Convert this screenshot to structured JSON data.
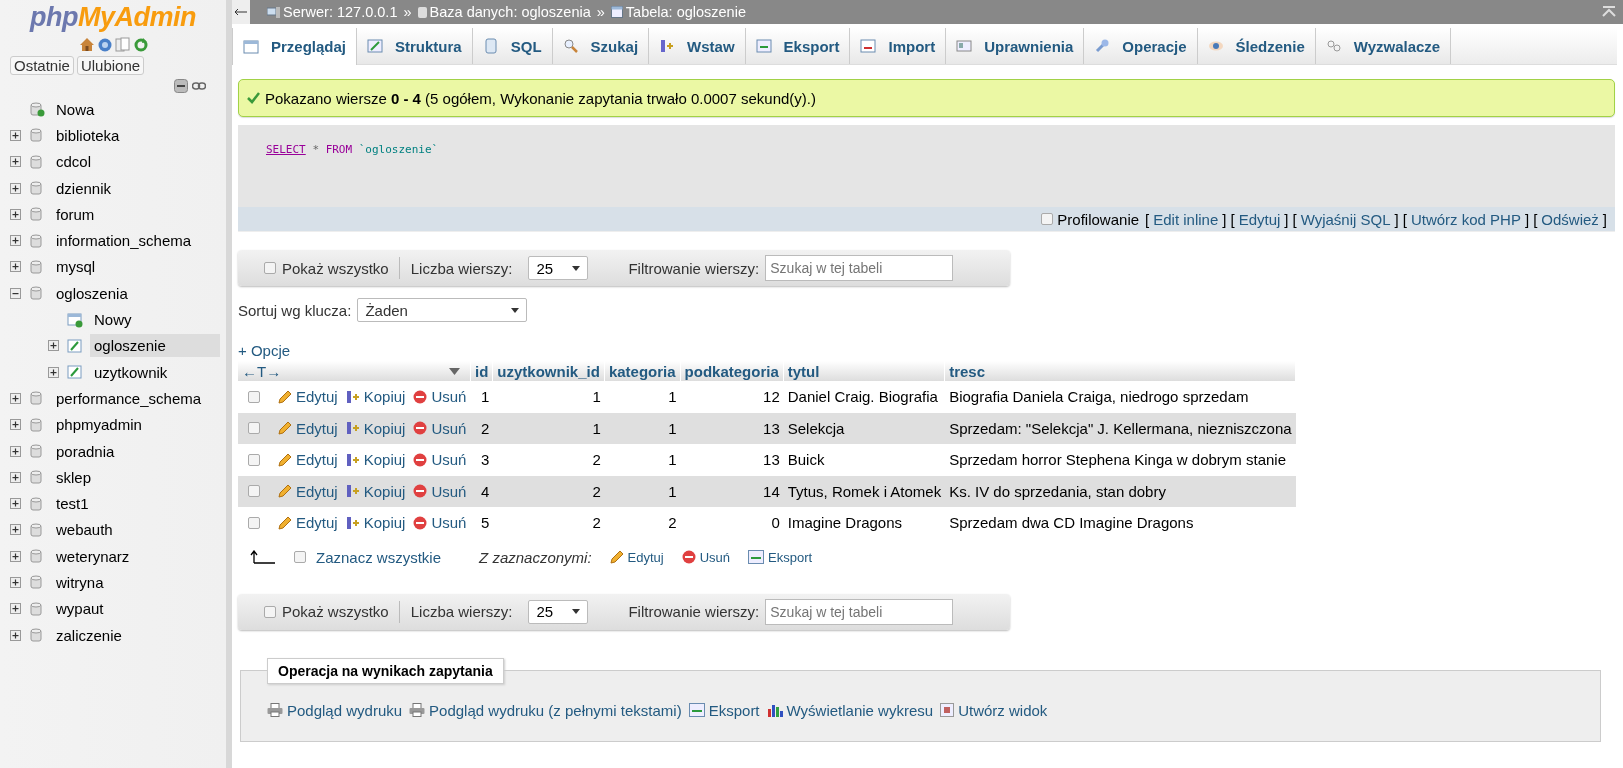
{
  "logo": [
    "php",
    "MyAdmin"
  ],
  "sidebar_tabs": [
    "Ostatnie",
    "Ulubione"
  ],
  "tree": [
    {
      "label": "Nowa",
      "kind": "new",
      "selected": false
    },
    {
      "label": "biblioteka",
      "kind": "db",
      "expanded": false,
      "selected": false
    },
    {
      "label": "cdcol",
      "kind": "db",
      "expanded": false,
      "selected": false
    },
    {
      "label": "dziennik",
      "kind": "db",
      "expanded": false,
      "selected": false
    },
    {
      "label": "forum",
      "kind": "db",
      "expanded": false,
      "selected": false
    },
    {
      "label": "information_schema",
      "kind": "db",
      "expanded": false,
      "selected": false
    },
    {
      "label": "mysql",
      "kind": "db",
      "expanded": false,
      "selected": false
    },
    {
      "label": "ogloszenia",
      "kind": "db",
      "expanded": true,
      "selected": false,
      "children": [
        {
          "label": "Nowy",
          "kind": "new",
          "selected": false
        },
        {
          "label": "ogloszenie",
          "kind": "table",
          "expanded": false,
          "selected": true
        },
        {
          "label": "uzytkownik",
          "kind": "table",
          "expanded": false,
          "selected": false
        }
      ]
    },
    {
      "label": "performance_schema",
      "kind": "db",
      "expanded": false,
      "selected": false
    },
    {
      "label": "phpmyadmin",
      "kind": "db",
      "expanded": false,
      "selected": false
    },
    {
      "label": "poradnia",
      "kind": "db",
      "expanded": false,
      "selected": false
    },
    {
      "label": "sklep",
      "kind": "db",
      "expanded": false,
      "selected": false
    },
    {
      "label": "test1",
      "kind": "db",
      "expanded": false,
      "selected": false
    },
    {
      "label": "webauth",
      "kind": "db",
      "expanded": false,
      "selected": false
    },
    {
      "label": "weterynarz",
      "kind": "db",
      "expanded": false,
      "selected": false
    },
    {
      "label": "witryna",
      "kind": "db",
      "expanded": false,
      "selected": false
    },
    {
      "label": "wypaut",
      "kind": "db",
      "expanded": false,
      "selected": false
    },
    {
      "label": "zaliczenie",
      "kind": "db",
      "expanded": false,
      "selected": false
    }
  ],
  "breadcrumb_separator": "»",
  "breadcrumb": [
    {
      "kind": "server",
      "label": "Serwer: 127.0.0.1"
    },
    {
      "kind": "db",
      "label": "Baza danych: ogloszenia"
    },
    {
      "kind": "table",
      "label": "Tabela: ogloszenie"
    }
  ],
  "tabs": [
    {
      "label": "Przeglądaj",
      "selected": true
    },
    {
      "label": "Struktura",
      "selected": false
    },
    {
      "label": "SQL",
      "selected": false
    },
    {
      "label": "Szukaj",
      "selected": false
    },
    {
      "label": "Wstaw",
      "selected": false
    },
    {
      "label": "Eksport",
      "selected": false
    },
    {
      "label": "Import",
      "selected": false
    },
    {
      "label": "Uprawnienia",
      "selected": false
    },
    {
      "label": "Operacje",
      "selected": false
    },
    {
      "label": "Śledzenie",
      "selected": false
    },
    {
      "label": "Wyzwalacze",
      "selected": false
    }
  ],
  "message": "Pokazano wiersze **0 - 4** (5 ogółem, Wykonanie zapytania trwało 0.0007 sekund(y).)",
  "sql": [
    {
      "kind": "keyword",
      "text": "SELECT"
    },
    {
      "kind": "operator",
      "text": "*"
    },
    {
      "kind": "keyword2",
      "text": "FROM"
    },
    {
      "kind": "identifier",
      "text": "`ogloszenie`"
    }
  ],
  "profiling": {
    "label": "Profilowanie",
    "checked": false,
    "bracket_open": "[",
    "bracket_close": "]",
    "links": [
      "Edit inline",
      "Edytuj",
      "Wyjaśnij SQL",
      "Utwórz kod PHP",
      "Odśwież"
    ]
  },
  "nav_bars": [
    {
      "show_all": {
        "label": "Pokaż wszystko",
        "checked": false
      },
      "rows_label": "Liczba wierszy:",
      "rows_value": "25",
      "filter_label": "Filtrowanie wierszy:",
      "filter_placeholder": "Szukaj w tej tabeli"
    },
    {
      "show_all": {
        "label": "Pokaż wszystko",
        "checked": false
      },
      "rows_label": "Liczba wierszy:",
      "rows_value": "25",
      "filter_label": "Filtrowanie wierszy:",
      "filter_placeholder": "Szukaj w tej tabeli"
    }
  ],
  "sort": {
    "label": "Sortuj wg klucza:",
    "value": "Żaden"
  },
  "options_link": "+ Opcje",
  "table": {
    "column_controls": "←T→",
    "columns": [
      "id",
      "uzytkownik_id",
      "kategoria",
      "podkategoria",
      "tytul",
      "tresc"
    ],
    "rows": [
      {
        "checked": false,
        "actions": [
          {
            "kind": "edit",
            "label": "Edytuj"
          },
          {
            "kind": "copy",
            "label": "Kopiuj"
          },
          {
            "kind": "delete",
            "label": "Usuń"
          }
        ],
        "cells": [
          "1",
          "1",
          "1",
          "12",
          "Daniel Craig. Biografia",
          "Biografia Daniela Craiga, niedrogo sprzedam"
        ]
      },
      {
        "checked": false,
        "actions": [
          {
            "kind": "edit",
            "label": "Edytuj"
          },
          {
            "kind": "copy",
            "label": "Kopiuj"
          },
          {
            "kind": "delete",
            "label": "Usuń"
          }
        ],
        "cells": [
          "2",
          "1",
          "1",
          "13",
          "Selekcja",
          "Sprzedam: \"Selekcja\" J. Kellermana, niezniszczona"
        ]
      },
      {
        "checked": false,
        "actions": [
          {
            "kind": "edit",
            "label": "Edytuj"
          },
          {
            "kind": "copy",
            "label": "Kopiuj"
          },
          {
            "kind": "delete",
            "label": "Usuń"
          }
        ],
        "cells": [
          "3",
          "2",
          "1",
          "13",
          "Buick",
          "Sprzedam horror Stephena Kinga w dobrym stanie"
        ]
      },
      {
        "checked": false,
        "actions": [
          {
            "kind": "edit",
            "label": "Edytuj"
          },
          {
            "kind": "copy",
            "label": "Kopiuj"
          },
          {
            "kind": "delete",
            "label": "Usuń"
          }
        ],
        "cells": [
          "4",
          "2",
          "1",
          "14",
          "Tytus, Romek i Atomek",
          "Ks. IV do sprzedania, stan dobry"
        ]
      },
      {
        "checked": false,
        "actions": [
          {
            "kind": "edit",
            "label": "Edytuj"
          },
          {
            "kind": "copy",
            "label": "Kopiuj"
          },
          {
            "kind": "delete",
            "label": "Usuń"
          }
        ],
        "cells": [
          "5",
          "2",
          "2",
          "0",
          "Imagine Dragons",
          "Sprzedam dwa CD Imagine Dragons"
        ]
      }
    ]
  },
  "bulk": {
    "check_all": {
      "label": "Zaznacz wszystkie",
      "checked": false
    },
    "with_selected": "Z zaznaczonymi:",
    "actions": [
      {
        "kind": "edit",
        "label": "Edytuj"
      },
      {
        "kind": "delete",
        "label": "Usuń"
      },
      {
        "kind": "export",
        "label": "Eksport"
      }
    ]
  },
  "operations": {
    "legend": "Operacja na wynikach zapytania",
    "links": [
      {
        "kind": "print",
        "label": "Podgląd wydruku"
      },
      {
        "kind": "print",
        "label": "Podgląd wydruku (z pełnymi tekstami)"
      },
      {
        "kind": "export",
        "label": "Eksport"
      },
      {
        "kind": "chart",
        "label": "Wyświetlanie wykresu"
      },
      {
        "kind": "view",
        "label": "Utwórz widok"
      }
    ]
  }
}
